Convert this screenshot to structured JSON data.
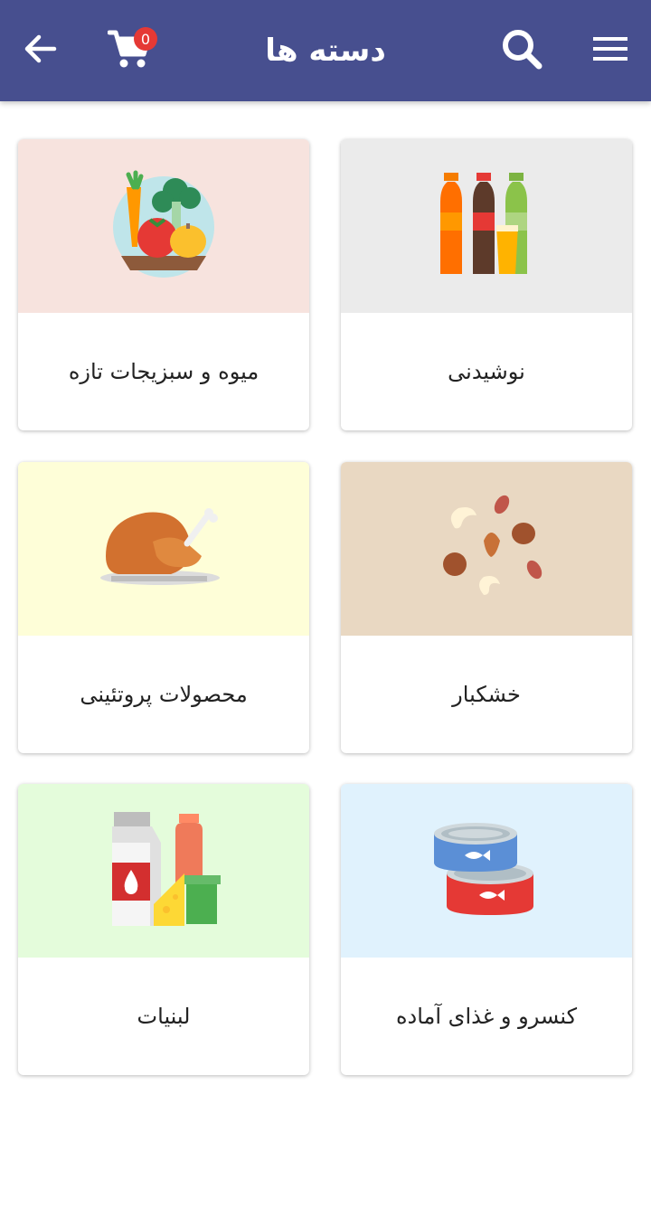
{
  "header": {
    "title": "دسته ها",
    "cart_count": "0",
    "background": "#474f8f",
    "icons": [
      "back-arrow-icon",
      "cart-icon",
      "search-icon",
      "menu-icon"
    ]
  },
  "categories": [
    {
      "label": "نوشیدنی",
      "bg": "#ebebeb",
      "icon": "bottles-icon"
    },
    {
      "label": "میوه و سبزیجات تازه",
      "bg": "#f7e3de",
      "icon": "vegetables-icon"
    },
    {
      "label": "خشکبار",
      "bg": "#e9d8c2",
      "icon": "nuts-icon"
    },
    {
      "label": "محصولات پروتئینی",
      "bg": "#fefed8",
      "icon": "roast-chicken-icon"
    },
    {
      "label": "کنسرو و غذای آماده",
      "bg": "#e0f2fd",
      "icon": "canned-fish-icon"
    },
    {
      "label": "لبنیات",
      "bg": "#e4fcdb",
      "icon": "dairy-icon"
    }
  ]
}
